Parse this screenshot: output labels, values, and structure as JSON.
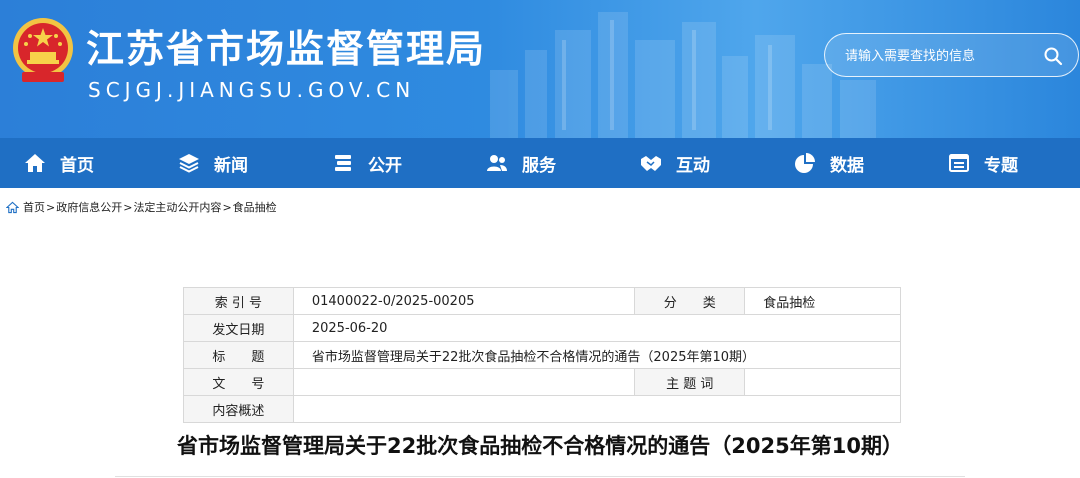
{
  "header": {
    "site_title": "江苏省市场监督管理局",
    "site_domain": "SCJGJ.JIANGSU.GOV.CN",
    "search_placeholder": "请输入需要查找的信息",
    "emblem_icon": "national-emblem-icon",
    "search_icon": "search-icon"
  },
  "nav": {
    "items": [
      {
        "label": "首页",
        "icon": "home-icon"
      },
      {
        "label": "新闻",
        "icon": "layers-icon"
      },
      {
        "label": "公开",
        "icon": "stack-icon"
      },
      {
        "label": "服务",
        "icon": "users-icon"
      },
      {
        "label": "互动",
        "icon": "handshake-icon"
      },
      {
        "label": "数据",
        "icon": "pie-chart-icon"
      },
      {
        "label": "专题",
        "icon": "window-icon"
      }
    ]
  },
  "breadcrumb": {
    "items": [
      "首页",
      "政府信息公开",
      "法定主动公开内容",
      "食品抽检"
    ],
    "separator": ">"
  },
  "info_table": {
    "index_label": "索 引 号",
    "index_value": "01400022-0/2025-00205",
    "category_label": "分　　类",
    "category_value": "食品抽检",
    "date_label": "发文日期",
    "date_value": "2025-06-20",
    "title_label": "标　　题",
    "title_value": "省市场监督管理局关于22批次食品抽检不合格情况的通告（2025年第10期）",
    "docno_label": "文　　号",
    "docno_value": "",
    "subject_label": "主 题 词",
    "subject_value": "",
    "summary_label": "内容概述",
    "summary_value": ""
  },
  "document": {
    "title": "省市场监督管理局关于22批次食品抽检不合格情况的通告（2025年第10期）"
  },
  "colors": {
    "banner_blue": "#2c7fd8",
    "nav_blue": "#1f6fc4",
    "table_border": "#d8d8d8",
    "label_bg": "#f5f5f5"
  }
}
